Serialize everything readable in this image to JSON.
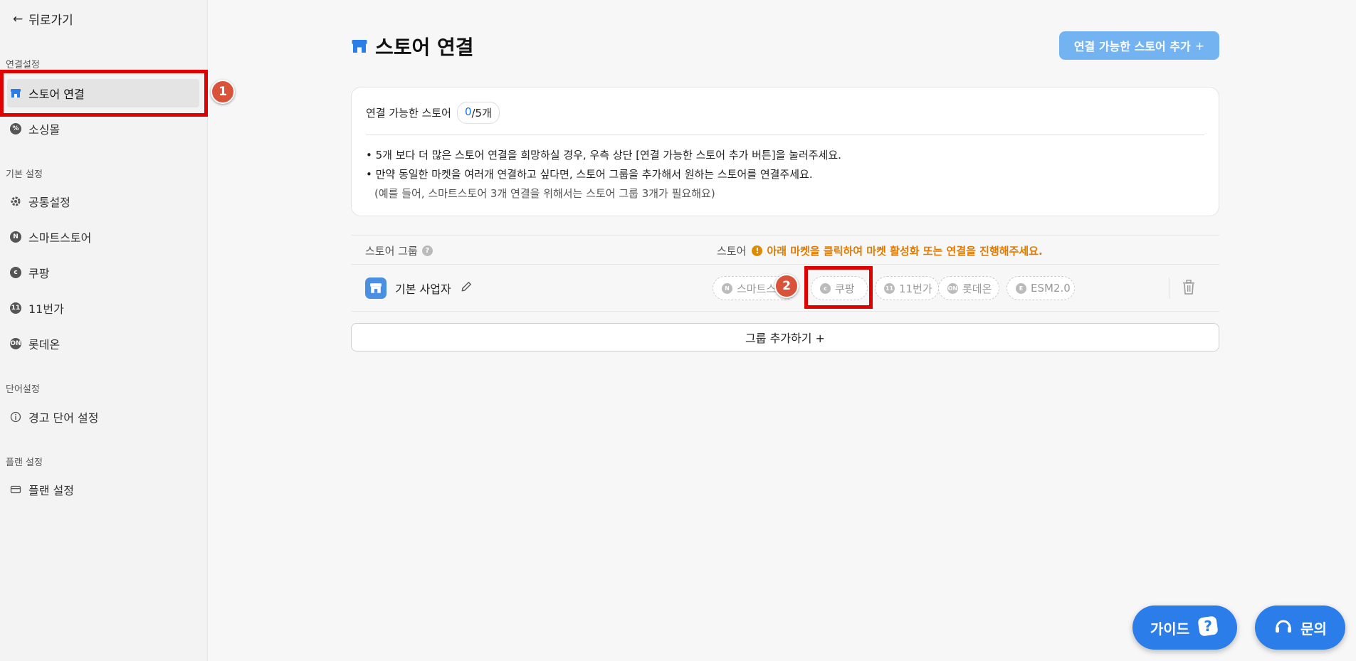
{
  "sidebar": {
    "back_label": "뒤로가기",
    "sections": {
      "connection": "연결설정",
      "basic": "기본 설정",
      "words": "단어설정",
      "plan": "플랜 설정"
    },
    "items": {
      "store_connect": "스토어 연결",
      "sourcing_mall": "소싱몰",
      "common_settings": "공통설정",
      "smartstore": "스마트스토어",
      "coupang": "쿠팡",
      "st11": "11번가",
      "lotteon": "롯데온",
      "warning_words": "경고 단어 설정",
      "plan_settings": "플랜 설정"
    }
  },
  "page": {
    "title": "스토어 연결",
    "add_store_button": "연결 가능한 스토어 추가",
    "add_plus": "+"
  },
  "info": {
    "label": "연결 가능한 스토어",
    "count_used": "0",
    "count_total": "/5개",
    "line1": "• 5개 보다 더 많은 스토어 연결을 희망하실 경우, 우측 상단 [연결 가능한 스토어 추가 버튼]을 눌러주세요.",
    "line2": "• 만약 동일한 마켓을 여러개 연결하고 싶다면, 스토어 그룹을 추가해서 원하는 스토어를 연결주세요.",
    "line3": "(예를 들어, 스마트스토어 3개 연결을 위해서는 스토어 그룹 3개가 필요해요)"
  },
  "table": {
    "col_group": "스토어 그룹",
    "col_store": "스토어",
    "warning": "아래 마켓을 클릭하여 마켓 활성화 또는 연결을 진행해주세요.",
    "group_name": "기본 사업자",
    "markets": [
      "스마트스토어",
      "쿠팡",
      "11번가",
      "롯데온",
      "ESM2.0"
    ]
  },
  "add_group_label": "그룹 추가하기 +",
  "annotations": {
    "one": "1",
    "two": "2"
  },
  "fab": {
    "guide": "가이드",
    "inquiry": "문의"
  },
  "colors": {
    "accent": "#2b7de9",
    "highlight": "#e00000",
    "warning": "#e07b00"
  }
}
